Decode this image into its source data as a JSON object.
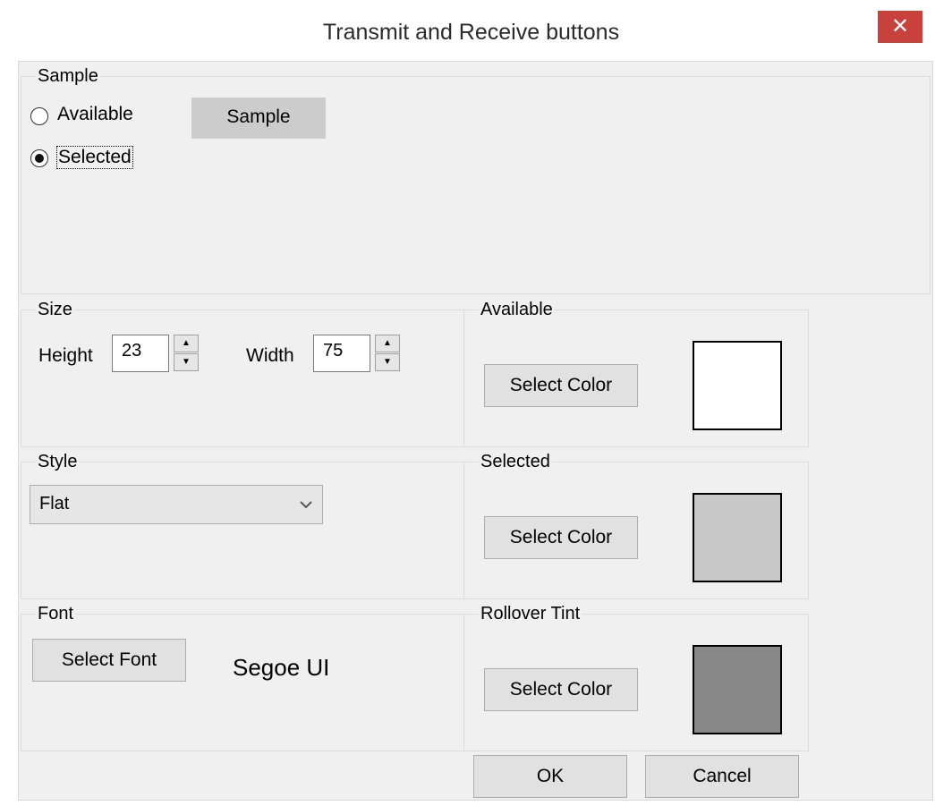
{
  "window": {
    "title": "Transmit and Receive buttons",
    "close_glyph": "✕"
  },
  "sample_group": {
    "legend": "Sample",
    "radio_available": "Available",
    "radio_selected": "Selected",
    "selected_option": "Selected",
    "sample_button": "Sample"
  },
  "size_group": {
    "legend": "Size",
    "height_label": "Height",
    "height_value": "23",
    "width_label": "Width",
    "width_value": "75"
  },
  "style_group": {
    "legend": "Style",
    "value": "Flat"
  },
  "font_group": {
    "legend": "Font",
    "select_button": "Select Font",
    "font_name": "Segoe UI"
  },
  "available_group": {
    "legend": "Available",
    "select_button": "Select Color",
    "swatch_color": "#ffffff"
  },
  "selected_group": {
    "legend": "Selected",
    "select_button": "Select Color",
    "swatch_color": "#c8c8c8"
  },
  "rollover_group": {
    "legend": "Rollover Tint",
    "select_button": "Select Color",
    "swatch_color": "#888888"
  },
  "footer": {
    "ok": "OK",
    "cancel": "Cancel"
  },
  "colors": {
    "close_red": "#c7423c",
    "dialog_bg": "#f0f0f0",
    "button_bg": "#e1e1e1"
  }
}
